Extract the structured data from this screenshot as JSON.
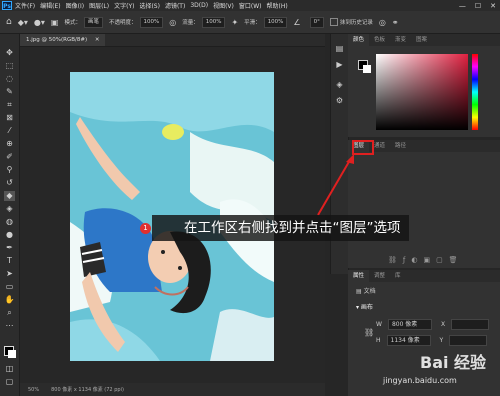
{
  "menubar": {
    "logo": "Ps",
    "items": [
      "文件(F)",
      "编辑(E)",
      "图像(I)",
      "图层(L)",
      "文字(Y)",
      "选择(S)",
      "滤镜(T)",
      "3D(D)",
      "视图(V)",
      "窗口(W)",
      "帮助(H)"
    ],
    "min": "—",
    "max": "☐",
    "close": "✕"
  },
  "options": {
    "mode_label": "模式：",
    "mode_value": "画笔",
    "opacity_label": "不透明度：",
    "opacity_value": "100%",
    "erase_label": "抹到历史记录",
    "strength_label": "流量：",
    "strength_value": "100%",
    "smooth_label": "平滑：",
    "smooth_value": "100%",
    "angle_value": "0°"
  },
  "document": {
    "tab": "1.jpg @ 50%(RGB/8#)",
    "tab_close": "✕",
    "zoom": "50%",
    "dimensions": "800 像素 x 1134 像素 (72 ppi)"
  },
  "color_panel": {
    "tabs": [
      "颜色",
      "色板",
      "渐变",
      "图案"
    ]
  },
  "layers_panel": {
    "tabs": [
      "图层",
      "通道",
      "路径"
    ]
  },
  "properties_panel": {
    "tabs": [
      "属性",
      "调整",
      "库"
    ],
    "doc_label": "文档",
    "canvas_label": "画布",
    "w_label": "W",
    "w_value": "800 像素",
    "h_label": "H",
    "h_value": "1134 像素",
    "x_label": "X",
    "y_label": "Y"
  },
  "callout": {
    "badge": "1",
    "text": "在工作区右侧找到并点击“图层”选项"
  },
  "watermark": {
    "brand": "Bai 经验",
    "url": "jingyan.baidu.com"
  }
}
